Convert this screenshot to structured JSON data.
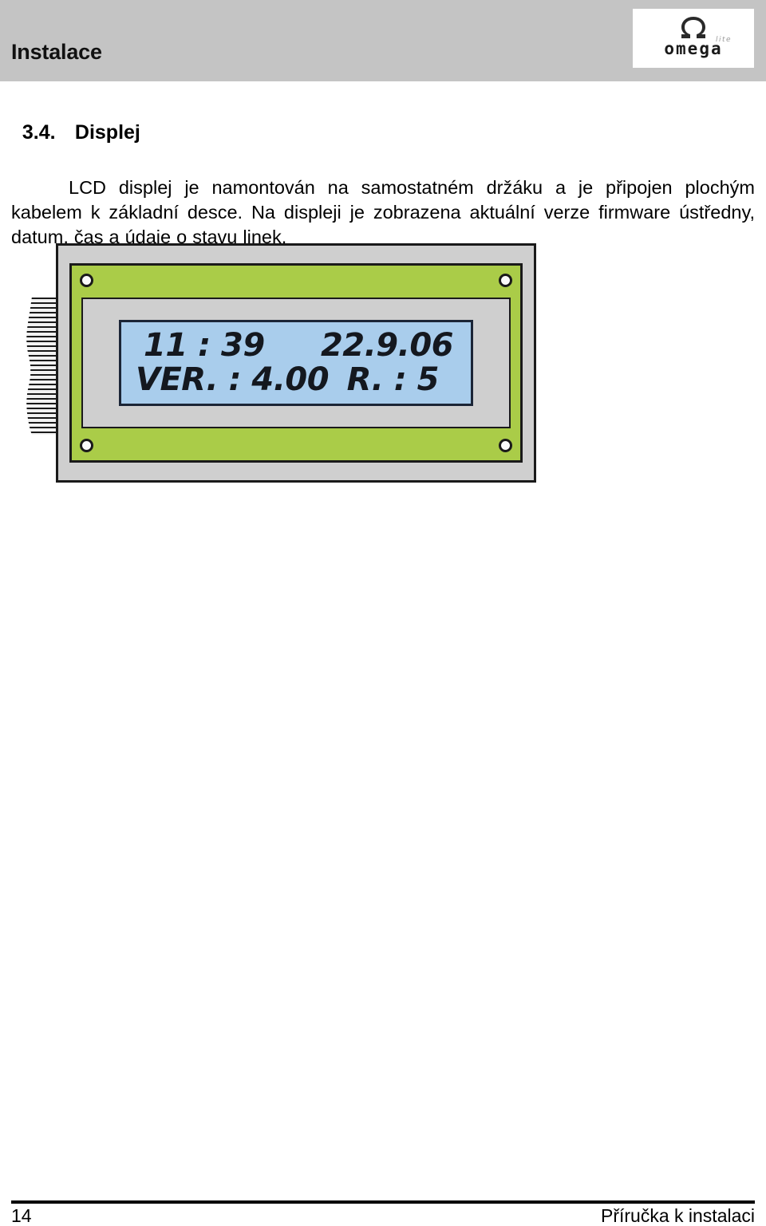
{
  "header": {
    "title": "Instalace",
    "logo": {
      "wordmark": "omega",
      "tagline": "lite",
      "symbol_icon": "omega-symbol-icon"
    },
    "band_color": "#c4c4c4"
  },
  "section": {
    "number": "3.4.",
    "title": "Displej"
  },
  "body": {
    "paragraph": "LCD displej je namontován na samostatném držáku a je připojen plochým kabelem k základní desce. Na displeji je zobrazena aktuální verze firmware ústředny, datum, čas a údaje o stavu linek."
  },
  "figure": {
    "name": "lcd-display-module",
    "colors": {
      "pcb_green": "#aacc48",
      "bezel_grey": "#cfcfcf",
      "lcd_blue": "#a9cdec",
      "outline_black": "#1a1a1a"
    },
    "lcd_screen": {
      "line1_left": "11 : 39",
      "line1_right": "22.9.06",
      "line2_left": "VER. : 4.00",
      "line2_right": "R. : 5"
    },
    "connector": {
      "label_icon": "ribbon-cable-icon"
    },
    "mounting_holes": 4
  },
  "footer": {
    "page_number": "14",
    "document_title": "Příručka k instalaci"
  }
}
